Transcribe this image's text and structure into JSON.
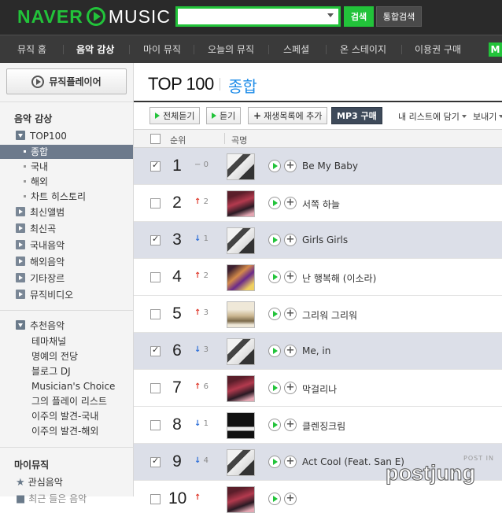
{
  "header": {
    "logo_left": "NAVER",
    "logo_right": "MUSIC",
    "search_value": "",
    "search_button": "검색",
    "total_search_button": "통합검색"
  },
  "gnb": {
    "items": [
      "뮤직 홈",
      "음악 감상",
      "마이 뮤직",
      "오늘의 뮤직",
      "스페셜",
      "온 스테이지",
      "이용권 구매"
    ],
    "active_index": 1,
    "corner_badge": "M"
  },
  "sidebar": {
    "player_button": "뮤직플레이어",
    "section1_title": "음악 감상",
    "top100": "TOP100",
    "top100_sub": [
      "종합",
      "국내",
      "해외",
      "차트 히스토리"
    ],
    "categories": [
      "최신앨범",
      "최신곡",
      "국내음악",
      "해외음악",
      "기타장르",
      "뮤직비디오"
    ],
    "recommend": "추천음악",
    "recommend_sub": [
      "테마채널",
      "명예의 전당",
      "블로그 DJ",
      "Musician's Choice",
      "그의 플레이 리스트",
      "이주의 발견-국내",
      "이주의 발견-해외"
    ],
    "section2_title": "마이뮤직",
    "favorites": "관심음악",
    "partial_item": "최근 들은 음악"
  },
  "main": {
    "title": "TOP 100",
    "subtitle": "종합",
    "toolbar": {
      "play_all": "전체듣기",
      "play": "듣기",
      "add_playlist": "재생목록에 추가",
      "mp3": "MP3 구매",
      "my_list": "내 리스트에 담기",
      "send": "보내기"
    },
    "table_header": {
      "rank": "순위",
      "title": "곡명"
    },
    "rows": [
      {
        "rank": "1",
        "change_dir": "same",
        "change_symbol": "−",
        "change_value": "0",
        "title": "Be My Baby",
        "checked": true
      },
      {
        "rank": "2",
        "change_dir": "up",
        "change_symbol": "↑",
        "change_value": "2",
        "title": "서쪽 하늘",
        "checked": false
      },
      {
        "rank": "3",
        "change_dir": "down",
        "change_symbol": "↓",
        "change_value": "1",
        "title": "Girls Girls",
        "checked": true
      },
      {
        "rank": "4",
        "change_dir": "up",
        "change_symbol": "↑",
        "change_value": "2",
        "title": "난 행복해 (이소라)",
        "checked": false
      },
      {
        "rank": "5",
        "change_dir": "up",
        "change_symbol": "↑",
        "change_value": "3",
        "title": "그리워 그리워",
        "checked": false
      },
      {
        "rank": "6",
        "change_dir": "down",
        "change_symbol": "↓",
        "change_value": "3",
        "title": "Me, in",
        "checked": true
      },
      {
        "rank": "7",
        "change_dir": "up",
        "change_symbol": "↑",
        "change_value": "6",
        "title": "막걸리나",
        "checked": false
      },
      {
        "rank": "8",
        "change_dir": "down",
        "change_symbol": "↓",
        "change_value": "1",
        "title": "클렌징크림",
        "checked": false
      },
      {
        "rank": "9",
        "change_dir": "down",
        "change_symbol": "↓",
        "change_value": "4",
        "title": "Act Cool (Feat. San E)",
        "checked": true
      },
      {
        "rank": "10",
        "change_dir": "up",
        "change_symbol": "↑",
        "change_value": "",
        "title": "",
        "checked": false
      }
    ],
    "add_symbol": "+"
  },
  "watermark": {
    "top": "POST IN",
    "text": "postjung"
  },
  "colors": {
    "brand_green": "#22c33a",
    "selected_row": "#dcdfe8",
    "active_nav": "#6d7a8c",
    "title_blue": "#1e8ce8"
  }
}
